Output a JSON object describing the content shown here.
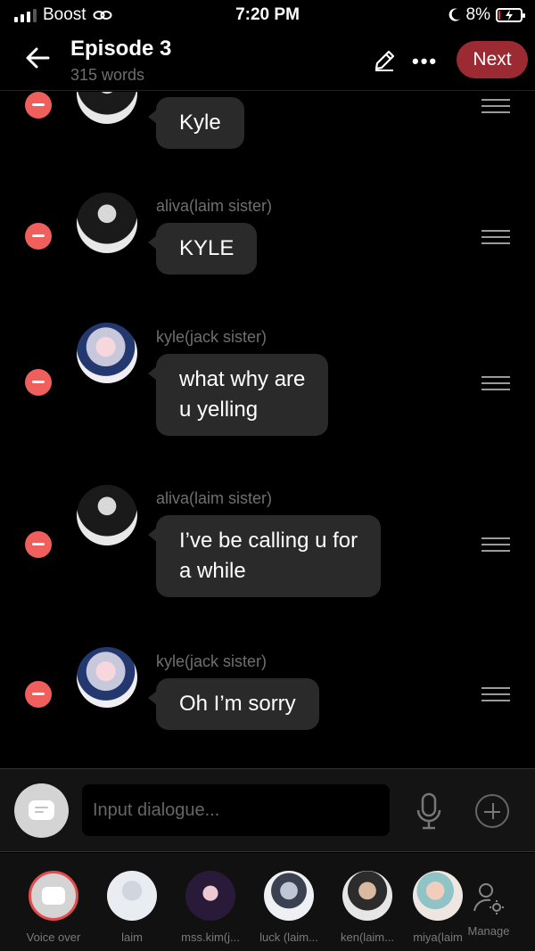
{
  "status_bar": {
    "carrier": "Boost",
    "time": "7:20 PM",
    "battery_percent": "8%",
    "battery_level": 0.08
  },
  "header": {
    "title": "Episode 3",
    "subtitle": "315 words",
    "next_label": "Next"
  },
  "messages": [
    {
      "speaker": "",
      "text": "Kyle",
      "avatar": "dark"
    },
    {
      "speaker": "aliva(laim sister)",
      "text": "KYLE",
      "avatar": "dark"
    },
    {
      "speaker": "kyle(jack sister)",
      "lines": [
        "what why are",
        "u yelling"
      ],
      "avatar": "pink"
    },
    {
      "speaker": "aliva(laim sister)",
      "lines": [
        "I’ve be calling u for",
        "a while"
      ],
      "avatar": "dark"
    },
    {
      "speaker": "kyle(jack sister)",
      "text": "Oh I’m sorry",
      "avatar": "pink"
    }
  ],
  "input": {
    "placeholder": "Input dialogue..."
  },
  "characters": [
    {
      "label": "Voice over"
    },
    {
      "label": "laim"
    },
    {
      "label": "mss.kim(j..."
    },
    {
      "label": "luck (laim..."
    },
    {
      "label": "ken(laim..."
    },
    {
      "label": "miya(laim"
    }
  ],
  "manage_label": "Manage",
  "colors": {
    "accent": "#9c2a33",
    "remove": "#ef5f5b",
    "bubble": "#2a2a2a"
  }
}
